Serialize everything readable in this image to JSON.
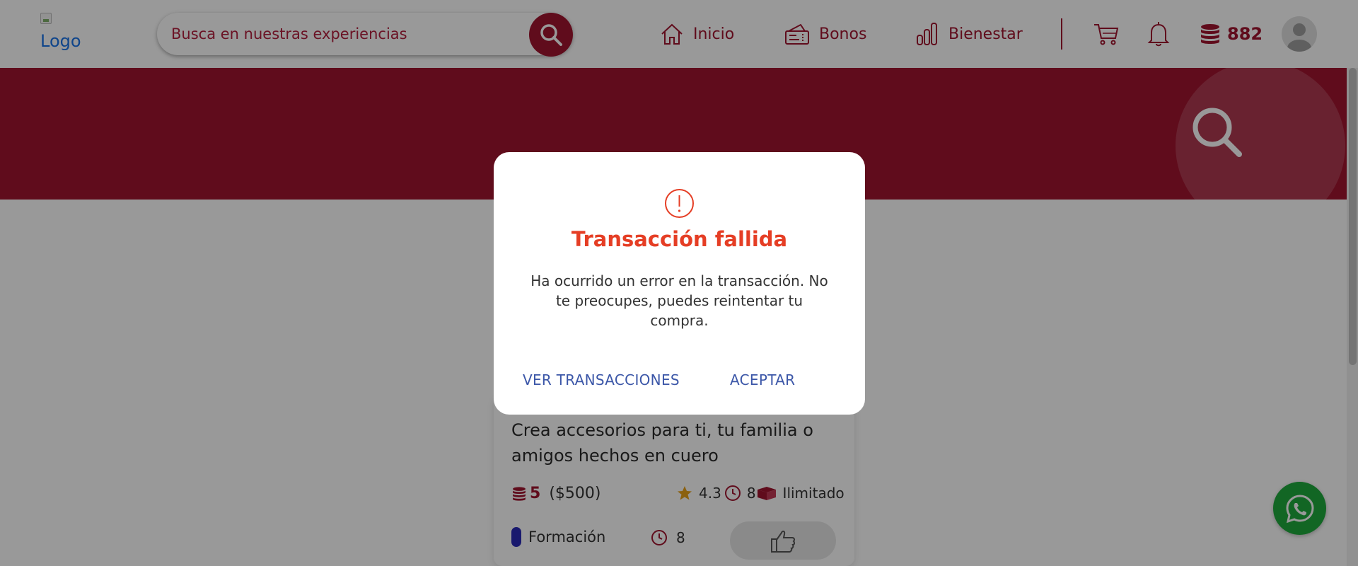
{
  "header": {
    "logo_alt": "Logo",
    "search": {
      "placeholder": "Busca en nuestras experiencias"
    },
    "nav": [
      {
        "label": "Inicio",
        "icon": "home-icon"
      },
      {
        "label": "Bonos",
        "icon": "voucher-icon"
      },
      {
        "label": "Bienestar",
        "icon": "bar-chart-icon"
      }
    ],
    "coins": "882"
  },
  "card": {
    "title": "Crea accesorios para ti, tu familia o amigos hechos en cuero",
    "price_coins": "5",
    "price_money": "($500)",
    "rating": "4.3",
    "duration": "8",
    "availability": "Ilimitado",
    "category": "Formación",
    "duration_2": "8"
  },
  "modal": {
    "title": "Transacción fallida",
    "message": "Ha ocurrido un error en la transacción. No te preocupes, puedes reintentar tu compra.",
    "btn_transactions": "VER TRANSACCIONES",
    "btn_accept": "ACEPTAR"
  },
  "colors": {
    "brand": "#a0142f",
    "error": "#e53e25",
    "link": "#3c57a8",
    "whatsapp": "#1faa3c"
  }
}
